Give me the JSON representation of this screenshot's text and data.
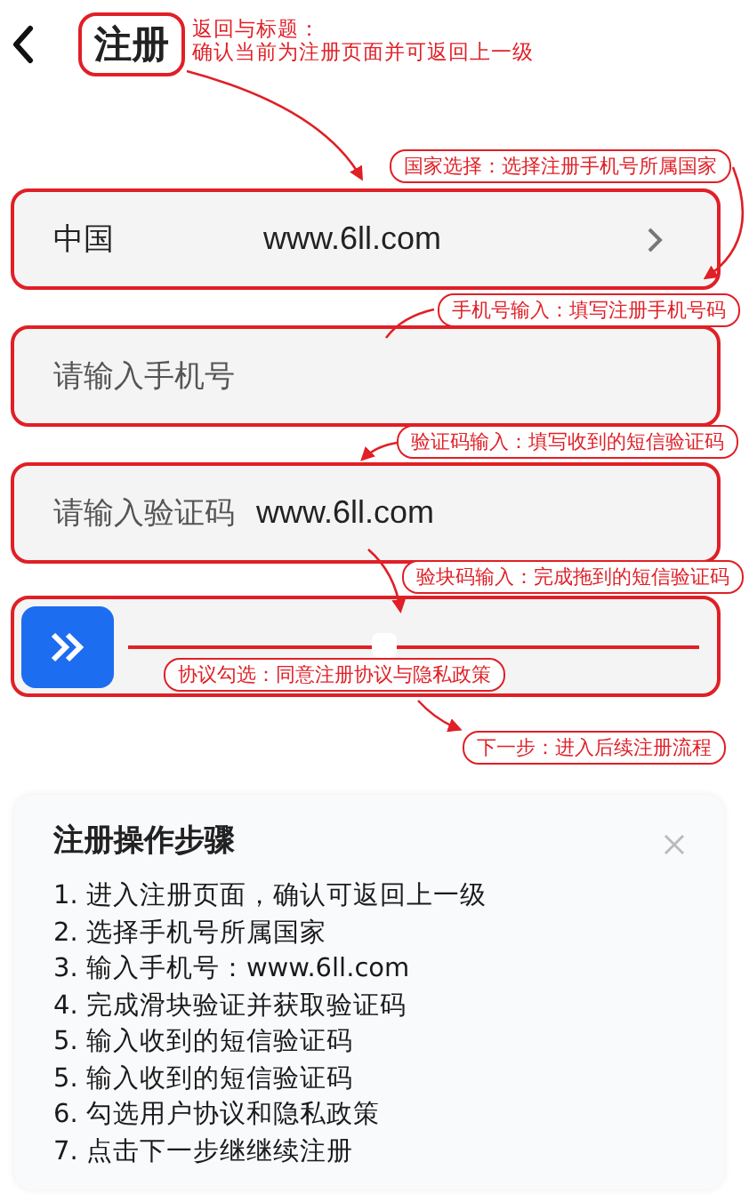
{
  "header": {
    "title": "注册"
  },
  "fields": [
    {
      "kind": "select",
      "label": "中国",
      "value": "www.6ll.com"
    },
    {
      "kind": "input",
      "placeholder": "请输入手机号"
    },
    {
      "kind": "input",
      "placeholder": "请输入验证码",
      "value": "www.6ll.com"
    }
  ],
  "slider": {
    "level": 0.45
  },
  "annotations": [
    {
      "kind": "note",
      "lines": [
        "返回与标题：",
        "确认当前为注册页面并可返回上一级"
      ]
    },
    {
      "kind": "pill",
      "lines": [
        "国家选择：选择注册手机号所属国家"
      ]
    },
    {
      "kind": "pill",
      "lines": [
        "手机号输入：填写注册手机号码"
      ]
    },
    {
      "kind": "pill",
      "lines": [
        "验证码输入：填写收到的短信验证码"
      ]
    },
    {
      "kind": "pill",
      "lines": [
        "验块码输入：完成拖到的短信验证码"
      ]
    },
    {
      "kind": "pill",
      "lines": [
        "协议勾选：同意注册协议与隐私政策"
      ]
    },
    {
      "kind": "pill",
      "lines": [
        "下一步：进入后续注册流程"
      ]
    }
  ],
  "steps": {
    "title": "注册操作步骤",
    "items": [
      "1. 进入注册页面，确认可返回上一级",
      "2. 选择手机号所属国家",
      "3. 输入手机号：www.6ll.com",
      "4. 完成滑块验证并获取验证码",
      "5. 输入收到的短信验证码",
      "5. 输入收到的短信验证码",
      "6. 勾选用户协议和隐私政策",
      "7. 点击下一步继继续注册"
    ]
  }
}
